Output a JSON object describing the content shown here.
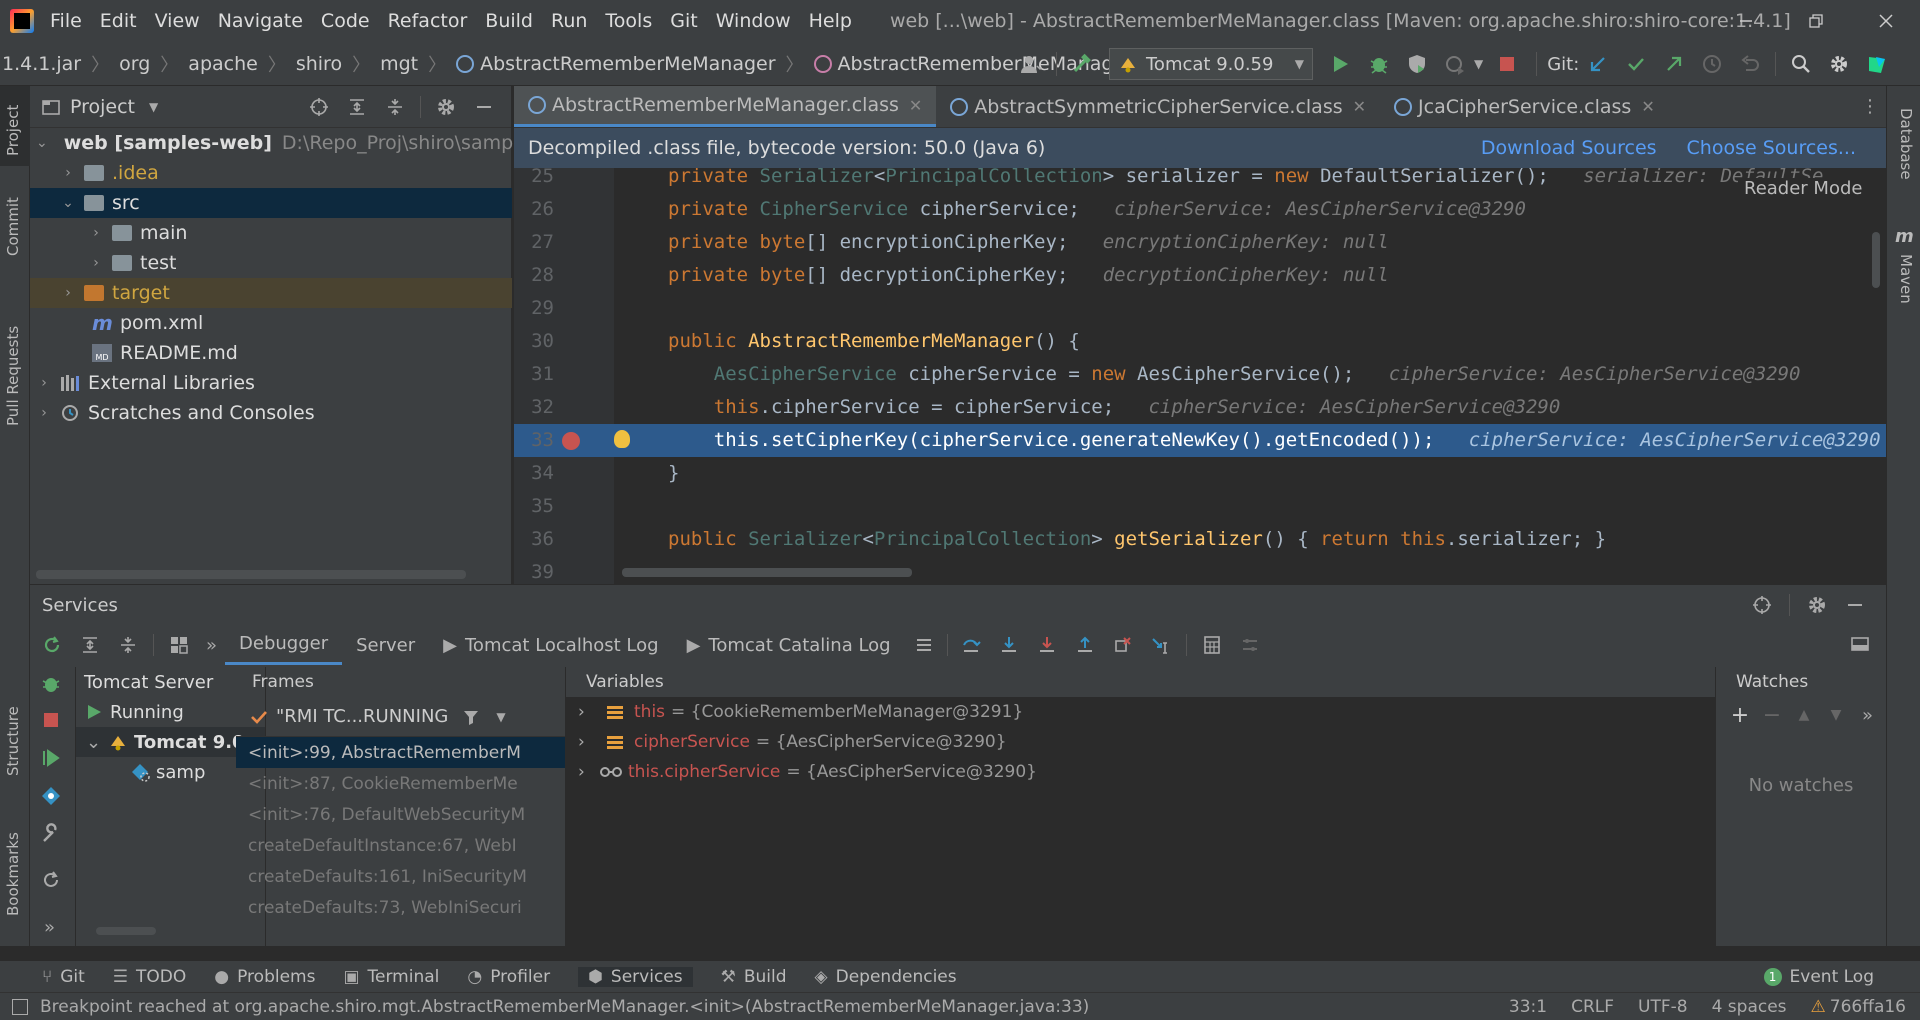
{
  "menubar": {
    "items": [
      "File",
      "Edit",
      "View",
      "Navigate",
      "Code",
      "Refactor",
      "Build",
      "Run",
      "Tools",
      "Git",
      "Window",
      "Help"
    ],
    "title": "web [...\\web] - AbstractRememberMeManager.class [Maven: org.apache.shiro:shiro-core:1.4.1]"
  },
  "navbar": {
    "crumbs": [
      "1.4.1.jar",
      "org",
      "apache",
      "shiro",
      "mgt",
      "AbstractRememberMeManager",
      "AbstractRememberMeManager"
    ],
    "run_config": "Tomcat 9.0.59",
    "git_label": "Git:"
  },
  "project": {
    "header": "Project",
    "tree": [
      {
        "label": "web [samples-web]",
        "hint": "D:\\Repo_Proj\\shiro\\samples",
        "indent": 0,
        "kind": "module",
        "open": true
      },
      {
        "label": ".idea",
        "indent": 1,
        "kind": "folder",
        "open": false
      },
      {
        "label": "src",
        "indent": 1,
        "kind": "folder",
        "open": true,
        "selected": true
      },
      {
        "label": "main",
        "indent": 2,
        "kind": "folder-blue",
        "open": false
      },
      {
        "label": "test",
        "indent": 2,
        "kind": "folder",
        "open": false
      },
      {
        "label": "target",
        "indent": 1,
        "kind": "folder-orange",
        "open": false,
        "highlight": true
      },
      {
        "label": "pom.xml",
        "indent": 1,
        "kind": "maven"
      },
      {
        "label": "README.md",
        "indent": 1,
        "kind": "md"
      },
      {
        "label": "External Libraries",
        "indent": 0,
        "kind": "lib",
        "open": false
      },
      {
        "label": "Scratches and Consoles",
        "indent": 0,
        "kind": "scratch",
        "open": false
      }
    ]
  },
  "left_stripe": {
    "tabs": [
      "Project",
      "Commit",
      "Pull Requests",
      "Structure",
      "Bookmarks"
    ]
  },
  "right_stripe": {
    "tabs": [
      "Database",
      "Maven"
    ]
  },
  "editor": {
    "tabs": [
      "AbstractRememberMeManager.class",
      "AbstractSymmetricCipherService.class",
      "JcaCipherService.class"
    ],
    "notice": "Decompiled .class file, bytecode version: 50.0 (Java 6)",
    "download_sources": "Download Sources",
    "choose_sources": "Choose Sources...",
    "reader_mode": "Reader Mode",
    "lines": [
      {
        "n": "25",
        "parts": [
          [
            "kw",
            "private "
          ],
          [
            "gen",
            "Serializer"
          ],
          [
            "ty",
            "<"
          ],
          [
            "gen",
            "PrincipalCollection"
          ],
          [
            "ty",
            "> serializer = "
          ],
          [
            "kw",
            "new "
          ],
          [
            "ty",
            "DefaultSerializer();  "
          ],
          [
            "cm",
            " serializer: DefaultSe"
          ]
        ]
      },
      {
        "n": "26",
        "parts": [
          [
            "kw",
            "private "
          ],
          [
            "gen",
            "CipherService "
          ],
          [
            "ty",
            "cipherService;  "
          ],
          [
            "cm",
            " cipherService: AesCipherService@3290"
          ]
        ]
      },
      {
        "n": "27",
        "parts": [
          [
            "kw",
            "private "
          ],
          [
            "kw",
            "byte"
          ],
          [
            "ty",
            "[] encryptionCipherKey;  "
          ],
          [
            "cm",
            " encryptionCipherKey: null"
          ]
        ]
      },
      {
        "n": "28",
        "parts": [
          [
            "kw",
            "private "
          ],
          [
            "kw",
            "byte"
          ],
          [
            "ty",
            "[] decryptionCipherKey;  "
          ],
          [
            "cm",
            " decryptionCipherKey: null"
          ]
        ]
      },
      {
        "n": "29",
        "parts": []
      },
      {
        "n": "30",
        "parts": [
          [
            "kw",
            "public "
          ],
          [
            "fn",
            "AbstractRememberMeManager"
          ],
          [
            "ty",
            "() {"
          ]
        ]
      },
      {
        "n": "31",
        "parts": [
          [
            "ty",
            "    "
          ],
          [
            "gen",
            "AesCipherService "
          ],
          [
            "ty",
            "cipherService = "
          ],
          [
            "kw",
            "new "
          ],
          [
            "ty",
            "AesCipherService();  "
          ],
          [
            "cm",
            " cipherService: AesCipherService@3290"
          ]
        ]
      },
      {
        "n": "32",
        "parts": [
          [
            "ty",
            "    "
          ],
          [
            "kw",
            "this"
          ],
          [
            "ty",
            ".cipherService = cipherService;  "
          ],
          [
            "cm",
            " cipherService: AesCipherService@3290"
          ]
        ]
      },
      {
        "n": "33",
        "parts": [
          [
            "ty",
            "    "
          ],
          [
            "kw",
            "this"
          ],
          [
            "ty",
            ".setCipherKey(cipherService.generateNewKey().getEncoded());  "
          ],
          [
            "cm",
            " cipherService: AesCipherService@3290"
          ]
        ],
        "current": true
      },
      {
        "n": "34",
        "parts": [
          [
            "ty",
            "}"
          ]
        ]
      },
      {
        "n": "35",
        "parts": []
      },
      {
        "n": "36",
        "parts": [
          [
            "kw",
            "public "
          ],
          [
            "gen",
            "Serializer"
          ],
          [
            "ty",
            "<"
          ],
          [
            "gen",
            "PrincipalCollection"
          ],
          [
            "ty",
            "> "
          ],
          [
            "fn",
            "getSerializer"
          ],
          [
            "ty",
            "() { "
          ],
          [
            "kw",
            "return this"
          ],
          [
            "ty",
            ".serializer; }"
          ]
        ]
      },
      {
        "n": "39",
        "parts": []
      }
    ]
  },
  "services": {
    "title": "Services",
    "tabs": [
      "Debugger",
      "Server",
      "Tomcat Localhost Log",
      "Tomcat Catalina Log"
    ],
    "tree": [
      {
        "label": "Tomcat Server",
        "indent": 0
      },
      {
        "label": "Running",
        "indent": 1,
        "icon": "run"
      },
      {
        "label": "Tomcat 9.0",
        "indent": 1,
        "icon": "tomcat",
        "bold": true,
        "open": true
      },
      {
        "label": "samp",
        "indent": 2,
        "icon": "deploy"
      }
    ],
    "frames_label": "Frames",
    "thread": "\"RMI TC...RUNNING",
    "frames": [
      "<init>:99, AbstractRememberM",
      "<init>:87, CookieRememberMe",
      "<init>:76, DefaultWebSecurityM",
      "createDefaultInstance:67, WebI",
      "createDefaults:161, IniSecurityM",
      "createDefaults:73, WebIniSecuri"
    ],
    "variables_label": "Variables",
    "variables": [
      {
        "name": "this",
        "value": "= {CookieRememberMeManager@3291}",
        "icon": "field"
      },
      {
        "name": "cipherService",
        "value": "= {AesCipherService@3290}",
        "icon": "field"
      },
      {
        "name": "this.cipherService",
        "value": "= {AesCipherService@3290}",
        "icon": "watch"
      }
    ],
    "watches_label": "Watches",
    "no_watches": "No watches"
  },
  "bottom_tabs": [
    "Git",
    "TODO",
    "Problems",
    "Terminal",
    "Profiler",
    "Services",
    "Build",
    "Dependencies"
  ],
  "event_log": {
    "count": "1",
    "label": "Event Log"
  },
  "status": {
    "message": "Breakpoint reached at org.apache.shiro.mgt.AbstractRememberMeManager.<init>(AbstractRememberMeManager.java:33)",
    "position": "33:1",
    "line_sep": "CRLF",
    "encoding": "UTF-8",
    "indent": "4 spaces",
    "branch": "766ffa16"
  },
  "colors": {
    "accent": "#4a88c7",
    "selection": "#214283",
    "breakpoint": "#c75450",
    "keyword": "#cc7832"
  }
}
